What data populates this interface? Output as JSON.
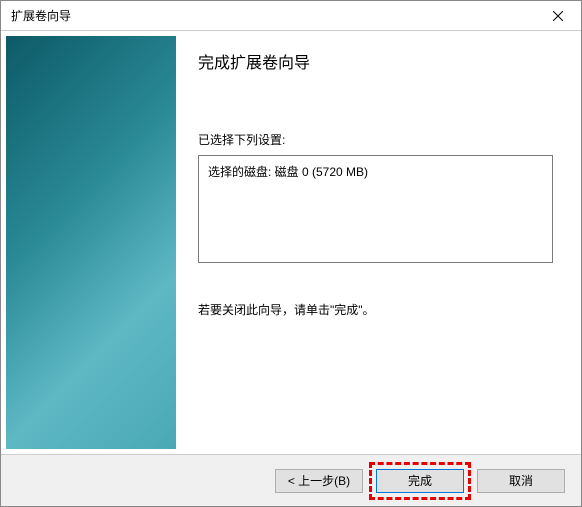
{
  "window": {
    "title": "扩展卷向导"
  },
  "content": {
    "heading": "完成扩展卷向导",
    "selected_label": "已选择下列设置:",
    "selected_value": "选择的磁盘: 磁盘 0 (5720 MB)",
    "instruction": "若要关闭此向导，请单击\"完成\"。"
  },
  "buttons": {
    "back": "< 上一步(B)",
    "finish": "完成",
    "cancel": "取消"
  }
}
